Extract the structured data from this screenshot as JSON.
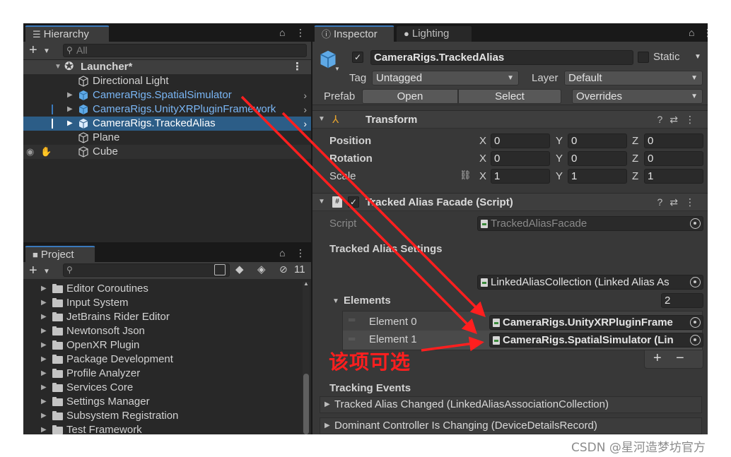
{
  "hierarchy": {
    "tab_label": "Hierarchy",
    "search_placeholder": "All",
    "scene_name": "Launcher*",
    "items": [
      {
        "label": "Directional Light"
      },
      {
        "label": "CameraRigs.SpatialSimulator"
      },
      {
        "label": "CameraRigs.UnityXRPluginFramework"
      },
      {
        "label": "CameraRigs.TrackedAlias"
      },
      {
        "label": "Plane"
      },
      {
        "label": "Cube"
      }
    ]
  },
  "project": {
    "tab_label": "Project",
    "hidden_count": "11",
    "folders": [
      {
        "label": "Editor Coroutines"
      },
      {
        "label": "Input System"
      },
      {
        "label": "JetBrains Rider Editor"
      },
      {
        "label": "Newtonsoft Json"
      },
      {
        "label": "OpenXR Plugin"
      },
      {
        "label": "Package Development"
      },
      {
        "label": "Profile Analyzer"
      },
      {
        "label": "Services Core"
      },
      {
        "label": "Settings Manager"
      },
      {
        "label": "Subsystem Registration"
      },
      {
        "label": "Test Framework"
      }
    ]
  },
  "inspector": {
    "tab_label": "Inspector",
    "lighting_tab_label": "Lighting",
    "object_name": "CameraRigs.TrackedAlias",
    "static_label": "Static",
    "tag_label": "Tag",
    "tag_value": "Untagged",
    "layer_label": "Layer",
    "layer_value": "Default",
    "prefab_label": "Prefab",
    "open_label": "Open",
    "select_label": "Select",
    "overrides_label": "Overrides",
    "transform": {
      "title": "Transform",
      "position_label": "Position",
      "rotation_label": "Rotation",
      "scale_label": "Scale",
      "x_label": "X",
      "y_label": "Y",
      "z_label": "Z",
      "position": [
        "0",
        "0",
        "0"
      ],
      "rotation": [
        "0",
        "0",
        "0"
      ],
      "scale": [
        "1",
        "1",
        "1"
      ]
    },
    "script_component": {
      "title": "Tracked Alias Facade (Script)",
      "script_label": "Script",
      "script_value": "TrackedAliasFacade",
      "settings_label": "Tracked Alias Settings",
      "linked_collection": "LinkedAliasCollection (Linked Alias As",
      "elements_label": "Elements",
      "elements_count": "2",
      "element0_label": "Element 0",
      "element0_value": "CameraRigs.UnityXRPluginFrame",
      "element1_label": "Element 1",
      "element1_value": "CameraRigs.SpatialSimulator (Lin",
      "plus_label": "+",
      "minus_label": "−",
      "events_label": "Tracking Events",
      "event1": "Tracked Alias Changed (LinkedAliasAssociationCollection)",
      "event2": "Dominant Controller Is Changing (DeviceDetailsRecord)"
    }
  },
  "annotation": {
    "text": "该项可选",
    "color": "#ff1f1f"
  },
  "watermark": "CSDN @星河造梦坊官方",
  "colors": {
    "selection": "#2c5d87",
    "link_blue": "#7ab6f5",
    "tab_accent": "#3a79bb"
  }
}
